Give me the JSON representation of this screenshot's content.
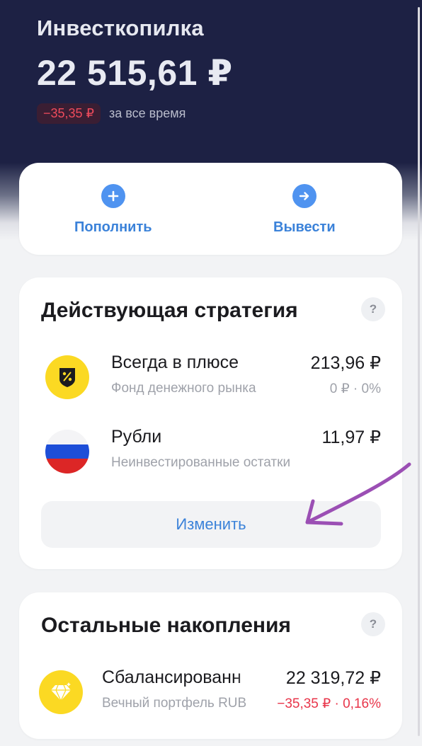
{
  "header": {
    "title": "Инвесткопилка",
    "balance": "22 515,61 ₽",
    "change": "−35,35 ₽",
    "change_caption": "за все время"
  },
  "actions": {
    "topup_label": "Пополнить",
    "withdraw_label": "Вывести"
  },
  "strategy": {
    "title": "Действующая стратегия",
    "help": "?",
    "funds": [
      {
        "name": "Всегда в плюсе",
        "sub": "Фонд денежного рынка",
        "value": "213,96 ₽",
        "meta": "0 ₽ · 0%",
        "icon": "percent-shield-icon"
      },
      {
        "name": "Рубли",
        "sub": "Неинвестированные остатки",
        "value": "11,97 ₽",
        "meta": "",
        "icon": "russia-flag-icon"
      }
    ],
    "change_button": "Изменить"
  },
  "savings": {
    "title": "Остальные накопления",
    "help": "?",
    "item": {
      "name": "Сбалансированн",
      "sub": "Вечный портфель RUB",
      "value": "22 319,72 ₽",
      "meta": "−35,35 ₽ · 0,16%",
      "icon": "diamond-icon"
    }
  },
  "colors": {
    "header_bg": "#1d2144",
    "accent": "#3b82d9",
    "negative": "#e8354a",
    "fund_yellow": "#fbd923"
  }
}
